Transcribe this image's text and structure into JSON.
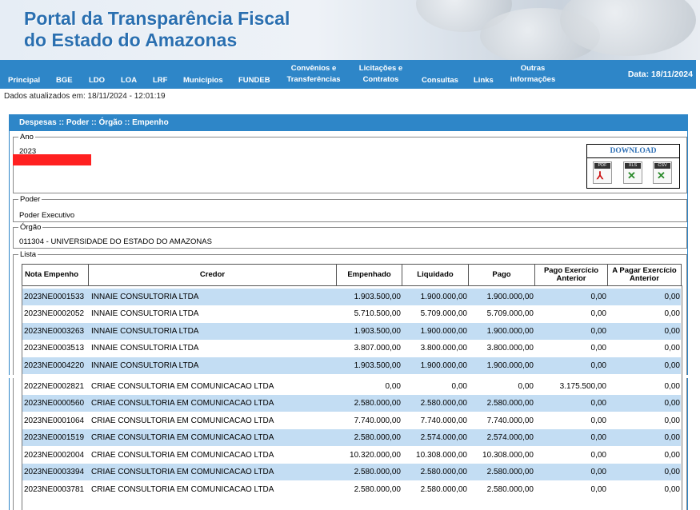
{
  "header": {
    "title_line1": "Portal da Transparência Fiscal",
    "title_line2": "do Estado do Amazonas"
  },
  "menu": {
    "items": [
      "Principal",
      "BGE",
      "LDO",
      "LOA",
      "LRF",
      "Municípios",
      "FUNDEB",
      "Convênios e Transferências",
      "Licitações e Contratos",
      "Consultas",
      "Links",
      "Outras informações"
    ],
    "date": "Data: 18/11/2024"
  },
  "updated": "Dados atualizados em: 18/11/2024 - 12:01:19",
  "panel": {
    "title": "Despesas :: Poder :: Órgão :: Empenho",
    "ano_legend": "Ano",
    "ano_value": "2023",
    "poder_legend": "Poder",
    "poder_value": "Poder Executivo",
    "orgao_legend": "Órgão",
    "orgao_value": "011304 - UNIVERSIDADE DO ESTADO DO AMAZONAS",
    "lista_legend": "Lista"
  },
  "download": {
    "title": "DOWNLOAD",
    "files": [
      {
        "label": "PDF",
        "icon": "pdf-icon",
        "color": "#cc1111"
      },
      {
        "label": "XLS",
        "icon": "xls-icon",
        "color": "#2a8a2a"
      },
      {
        "label": "CSV",
        "icon": "csv-icon",
        "color": "#2a8a2a"
      }
    ]
  },
  "table": {
    "columns": [
      "Nota Empenho",
      "Credor",
      "Empenhado",
      "Liquidado",
      "Pago",
      "Pago Exercício Anterior",
      "A Pagar Exercício Anterior"
    ],
    "rows": [
      [
        "2023NE0001533",
        "INNAIE CONSULTORIA LTDA",
        "1.903.500,00",
        "1.900.000,00",
        "1.900.000,00",
        "0,00",
        "0,00"
      ],
      [
        "2023NE0002052",
        "INNAIE CONSULTORIA LTDA",
        "5.710.500,00",
        "5.709.000,00",
        "5.709.000,00",
        "0,00",
        "0,00"
      ],
      [
        "2023NE0003263",
        "INNAIE CONSULTORIA LTDA",
        "1.903.500,00",
        "1.900.000,00",
        "1.900.000,00",
        "0,00",
        "0,00"
      ],
      [
        "2023NE0003513",
        "INNAIE CONSULTORIA LTDA",
        "3.807.000,00",
        "3.800.000,00",
        "3.800.000,00",
        "0,00",
        "0,00"
      ],
      [
        "2023NE0004220",
        "INNAIE CONSULTORIA LTDA",
        "1.903.500,00",
        "1.900.000,00",
        "1.900.000,00",
        "0,00",
        "0,00"
      ],
      [
        "2022NE0002821",
        "CRIAE CONSULTORIA EM COMUNICACAO LTDA",
        "0,00",
        "0,00",
        "0,00",
        "3.175.500,00",
        "0,00"
      ],
      [
        "2023NE0000560",
        "CRIAE CONSULTORIA EM COMUNICACAO LTDA",
        "2.580.000,00",
        "2.580.000,00",
        "2.580.000,00",
        "0,00",
        "0,00"
      ],
      [
        "2023NE0001064",
        "CRIAE CONSULTORIA EM COMUNICACAO LTDA",
        "7.740.000,00",
        "7.740.000,00",
        "7.740.000,00",
        "0,00",
        "0,00"
      ],
      [
        "2023NE0001519",
        "CRIAE CONSULTORIA EM COMUNICACAO LTDA",
        "2.580.000,00",
        "2.574.000,00",
        "2.574.000,00",
        "0,00",
        "0,00"
      ],
      [
        "2023NE0002004",
        "CRIAE CONSULTORIA EM COMUNICACAO LTDA",
        "10.320.000,00",
        "10.308.000,00",
        "10.308.000,00",
        "0,00",
        "0,00"
      ],
      [
        "2023NE0003394",
        "CRIAE CONSULTORIA EM COMUNICACAO LTDA",
        "2.580.000,00",
        "2.580.000,00",
        "2.580.000,00",
        "0,00",
        "0,00"
      ],
      [
        "2023NE0003781",
        "CRIAE CONSULTORIA EM COMUNICACAO LTDA",
        "2.580.000,00",
        "2.580.000,00",
        "2.580.000,00",
        "0,00",
        "0,00"
      ]
    ]
  },
  "colors": {
    "menu_bg": "#2e86c8",
    "row_blue": "#c3ddf3",
    "title_blue": "#2a6fb0"
  }
}
